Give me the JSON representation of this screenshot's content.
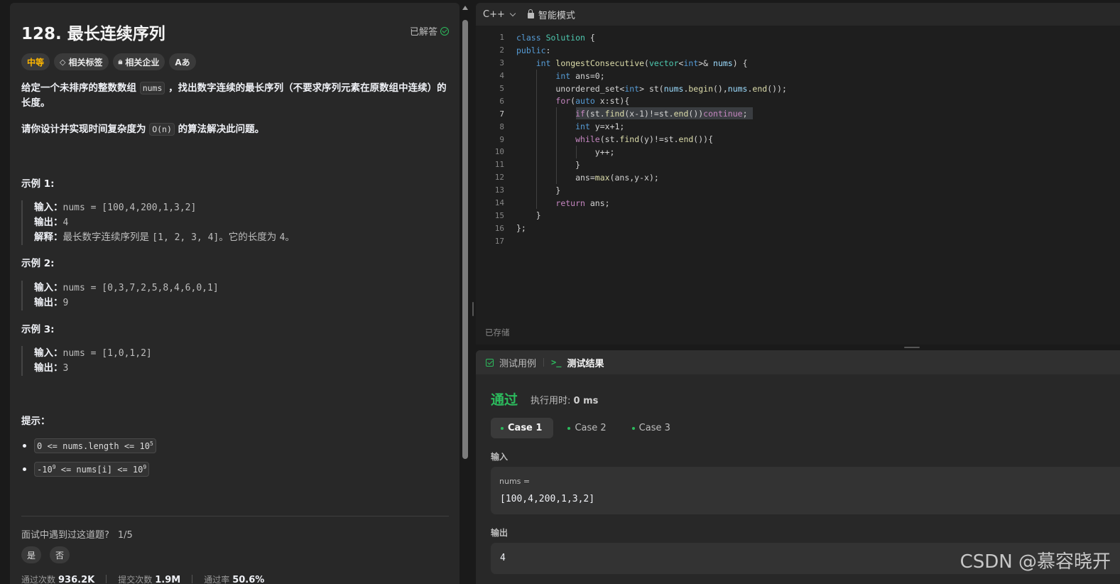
{
  "problem": {
    "title": "128. 最长连续序列",
    "solved_label": "已解答",
    "tags": [
      "中等",
      "相关标签",
      "相关企业",
      "Aあ"
    ],
    "desc1_a": "给定一个未排序的整数数组 ",
    "desc1_code": "nums",
    "desc1_b": " ，找出数字连续的最长序列（不要求序列元素在原数组中连续）的长度。",
    "desc2_a": "请你设计并实现时间复杂度为 ",
    "desc2_code": "O(n)",
    "desc2_b": " 的算法解决此问题。",
    "examples": [
      {
        "title": "示例 1:",
        "input_k": "输入：",
        "input_v": "nums = [100,4,200,1,3,2]",
        "output_k": "输出：",
        "output_v": "4",
        "explain_k": "解释：",
        "explain_v1": "最长数字连续序列是 ",
        "explain_code": "[1, 2, 3, 4]",
        "explain_v2": "。它的长度为 ",
        "explain_code2": "4",
        "explain_v3": "。"
      },
      {
        "title": "示例 2:",
        "input_k": "输入：",
        "input_v": "nums = [0,3,7,2,5,8,4,6,0,1]",
        "output_k": "输出：",
        "output_v": "9"
      },
      {
        "title": "示例 3:",
        "input_k": "输入：",
        "input_v": "nums = [1,0,1,2]",
        "output_k": "输出：",
        "output_v": "3"
      }
    ],
    "hints_title": "提示：",
    "hint1": "0 <= nums.length <= 10",
    "hint1_sup": "5",
    "hint2_pre": "-10",
    "hint2_sup1": "9",
    "hint2_mid": " <= nums[i] <= 10",
    "hint2_sup2": "9",
    "interview_q": "面试中遇到过这道题?",
    "interview_count": "1/5",
    "yes": "是",
    "no": "否",
    "stats": [
      {
        "label": "通过次数",
        "value": "936.2K"
      },
      {
        "label": "提交次数",
        "value": "1.9M"
      },
      {
        "label": "通过率",
        "value": "50.6%"
      }
    ]
  },
  "editor": {
    "language": "C++",
    "mode": "智能模式",
    "saved": "已存储",
    "line_numbers": [
      "1",
      "2",
      "3",
      "4",
      "5",
      "6",
      "7",
      "8",
      "9",
      "10",
      "11",
      "12",
      "13",
      "14",
      "15",
      "16",
      "17"
    ]
  },
  "result": {
    "tab_testcase": "测试用例",
    "tab_result": "测试结果",
    "terminal_glyph": ">_",
    "status": "通过",
    "runtime_label": "执行用时:",
    "runtime_value": "0 ms",
    "cases": [
      "Case 1",
      "Case 2",
      "Case 3"
    ],
    "input_label": "输入",
    "input_var": "nums =",
    "input_value": "[100,4,200,1,3,2]",
    "output_label": "输出",
    "output_value": "4"
  },
  "watermark": "CSDN @慕容晓开",
  "colors": {
    "accent_green": "#2cbb5d",
    "medium": "#ffb700"
  }
}
